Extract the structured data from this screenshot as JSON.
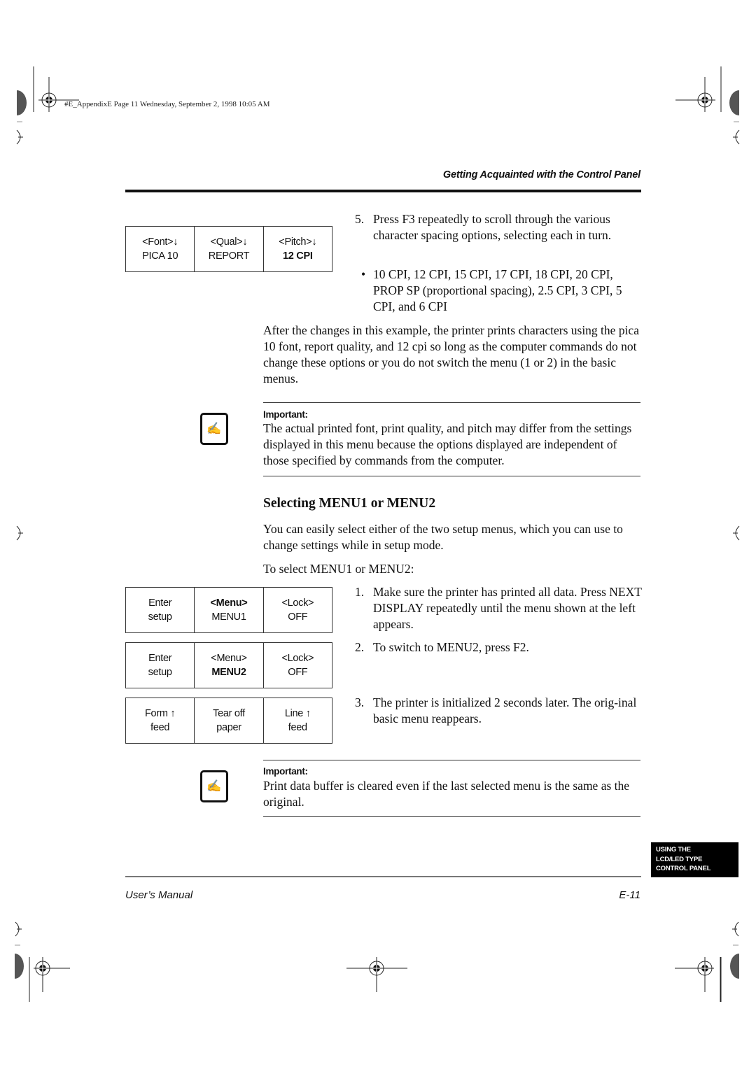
{
  "header": {
    "file_stamp": "#E_AppendixE  Page 11  Wednesday, September 2, 1998  10:05 AM",
    "running_head": "Getting Acquainted with the Control Panel"
  },
  "lcd_panels": [
    {
      "cells": [
        {
          "line1": "<Font>↓",
          "line2": "PICA 10",
          "bold_line": null
        },
        {
          "line1": "<Qual>↓",
          "line2": "REPORT",
          "bold_line": null
        },
        {
          "line1": "<Pitch>↓",
          "line2": "12 CPI",
          "bold_line": 2
        }
      ]
    },
    {
      "cells": [
        {
          "line1": "Enter",
          "line2": "setup",
          "bold_line": null
        },
        {
          "line1": "<Menu>",
          "line2": "MENU1",
          "bold_line": 1
        },
        {
          "line1": "<Lock>",
          "line2": "OFF",
          "bold_line": null
        }
      ]
    },
    {
      "cells": [
        {
          "line1": "Enter",
          "line2": "setup",
          "bold_line": null
        },
        {
          "line1": "<Menu>",
          "line2": "MENU2",
          "bold_line": 2
        },
        {
          "line1": "<Lock>",
          "line2": "OFF",
          "bold_line": null
        }
      ]
    },
    {
      "cells": [
        {
          "line1": "Form ↑",
          "line2": "feed",
          "bold_line": null
        },
        {
          "line1": "Tear off",
          "line2": "paper",
          "bold_line": null
        },
        {
          "line1": "Line ↑",
          "line2": "feed",
          "bold_line": null
        }
      ]
    }
  ],
  "content": {
    "step5": {
      "num": "5.",
      "text": "Press F3 repeatedly to scroll through the various character spacing options, selecting each in turn."
    },
    "bullet": {
      "symbol": "•",
      "text": "10 CPI, 12 CPI, 15 CPI, 17 CPI, 18 CPI, 20 CPI, PROP SP (proportional spacing), 2.5 CPI, 3 CPI, 5 CPI, and 6 CPI"
    },
    "after_changes": "After the changes in this example, the printer prints characters using the pica 10 font, report quality, and 12 cpi so long as the computer commands do not change these options or you do not switch the menu (1 or 2) in the basic menus.",
    "important1": {
      "label": "Important:",
      "icon": "writing-hand-icon",
      "text": "The actual printed font, print quality, and pitch may differ from the settings displayed in this menu because the options displayed are independent of those specified by commands from the computer."
    },
    "section_title": "Selecting MENU1 or MENU2",
    "intro": "You can easily select either of the two setup menus, which you can use to change settings while in setup mode.",
    "to_select": "To select MENU1 or MENU2:",
    "steps": [
      {
        "num": "1.",
        "text": "Make sure the printer has printed all data. Press NEXT DISPLAY repeatedly until the menu shown at the left appears."
      },
      {
        "num": "2.",
        "text": "To switch to MENU2, press F2."
      },
      {
        "num": "3.",
        "text": "The printer is initialized 2 seconds later. The orig-inal basic menu reappears."
      }
    ],
    "important2": {
      "label": "Important:",
      "icon": "writing-hand-icon",
      "text": "Print data buffer is cleared even if the last selected menu is the same as the original."
    }
  },
  "side_tab": {
    "lines": [
      "USING THE",
      "LCD/LED TYPE",
      "CONTROL PANEL"
    ]
  },
  "footer": {
    "left": "User’s Manual",
    "right": "E-11"
  }
}
